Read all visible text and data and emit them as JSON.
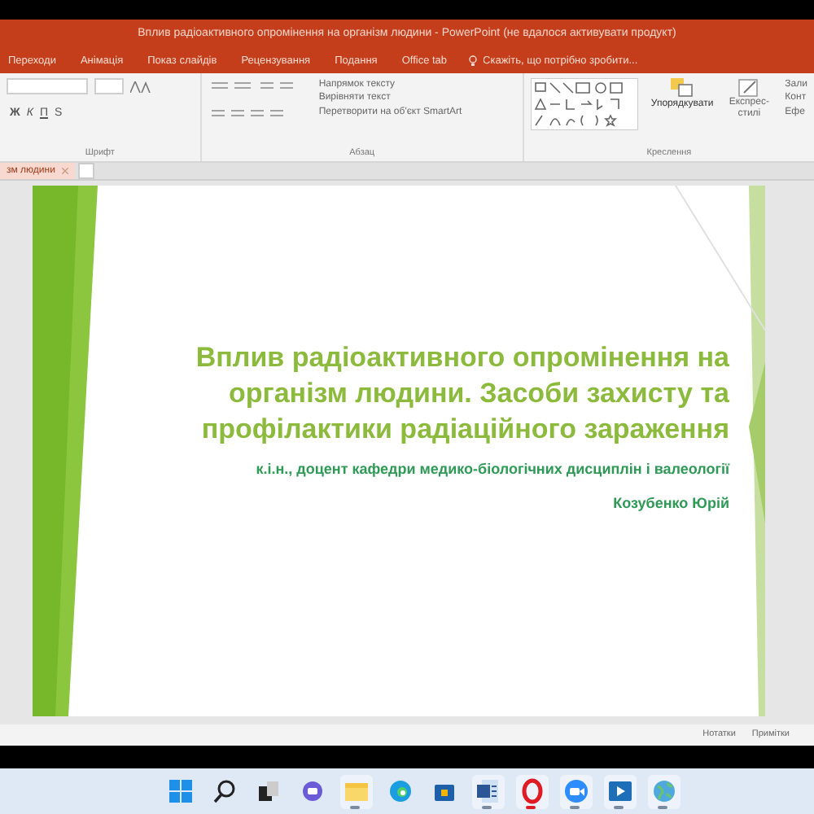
{
  "window": {
    "title": "Вплив радіоактивного опромінення на організм людини - PowerPoint (не вдалося активувати продукт)"
  },
  "ribbon_tabs": [
    {
      "label": "Переходи",
      "selected": false
    },
    {
      "label": "Анімація",
      "selected": false
    },
    {
      "label": "Показ слайдів",
      "selected": false
    },
    {
      "label": "Рецензування",
      "selected": false
    },
    {
      "label": "Подання",
      "selected": false
    },
    {
      "label": "Office tab",
      "selected": false
    }
  ],
  "tell_me": {
    "placeholder": "Скажіть, що потрібно зробити..."
  },
  "ribbon": {
    "font_group": {
      "label": "Шрифт",
      "buttons": [
        "Ж",
        "К",
        "П",
        "S"
      ]
    },
    "paragraph_group": {
      "label": "Абзац",
      "commands": [
        "Напрямок тексту",
        "Вирівняти текст",
        "Перетворити на об'єкт SmartArt"
      ]
    },
    "drawing_group": {
      "label": "Креслення",
      "commands": [
        "Упорядкувати",
        "Експрес-стилі"
      ],
      "cut_commands": [
        "Зали",
        "Конт",
        "Ефе"
      ]
    }
  },
  "document_tabs": [
    {
      "label": "зм людини",
      "selected": true
    }
  ],
  "slide": {
    "title": "Вплив радіоактивного опромінення на організм людини. Засоби захисту та профілактики радіаційного зараження",
    "subtitle": "к.і.н., доцент кафедри медико-біологічних дисциплін і валеології",
    "author": "Козубенко Юрій"
  },
  "status_bar": {
    "buttons": [
      "Нотатки",
      "Примітки"
    ]
  },
  "taskbar": [
    {
      "kind": "start",
      "running": false
    },
    {
      "kind": "search",
      "running": false
    },
    {
      "kind": "taskview",
      "running": false
    },
    {
      "kind": "chat",
      "running": false
    },
    {
      "kind": "folder",
      "running": true
    },
    {
      "kind": "browser",
      "running": false
    },
    {
      "kind": "store",
      "running": false
    },
    {
      "kind": "document",
      "running": true
    },
    {
      "kind": "ring",
      "running": true
    },
    {
      "kind": "camera",
      "running": true
    },
    {
      "kind": "play",
      "running": true
    },
    {
      "kind": "globe",
      "running": true
    }
  ]
}
